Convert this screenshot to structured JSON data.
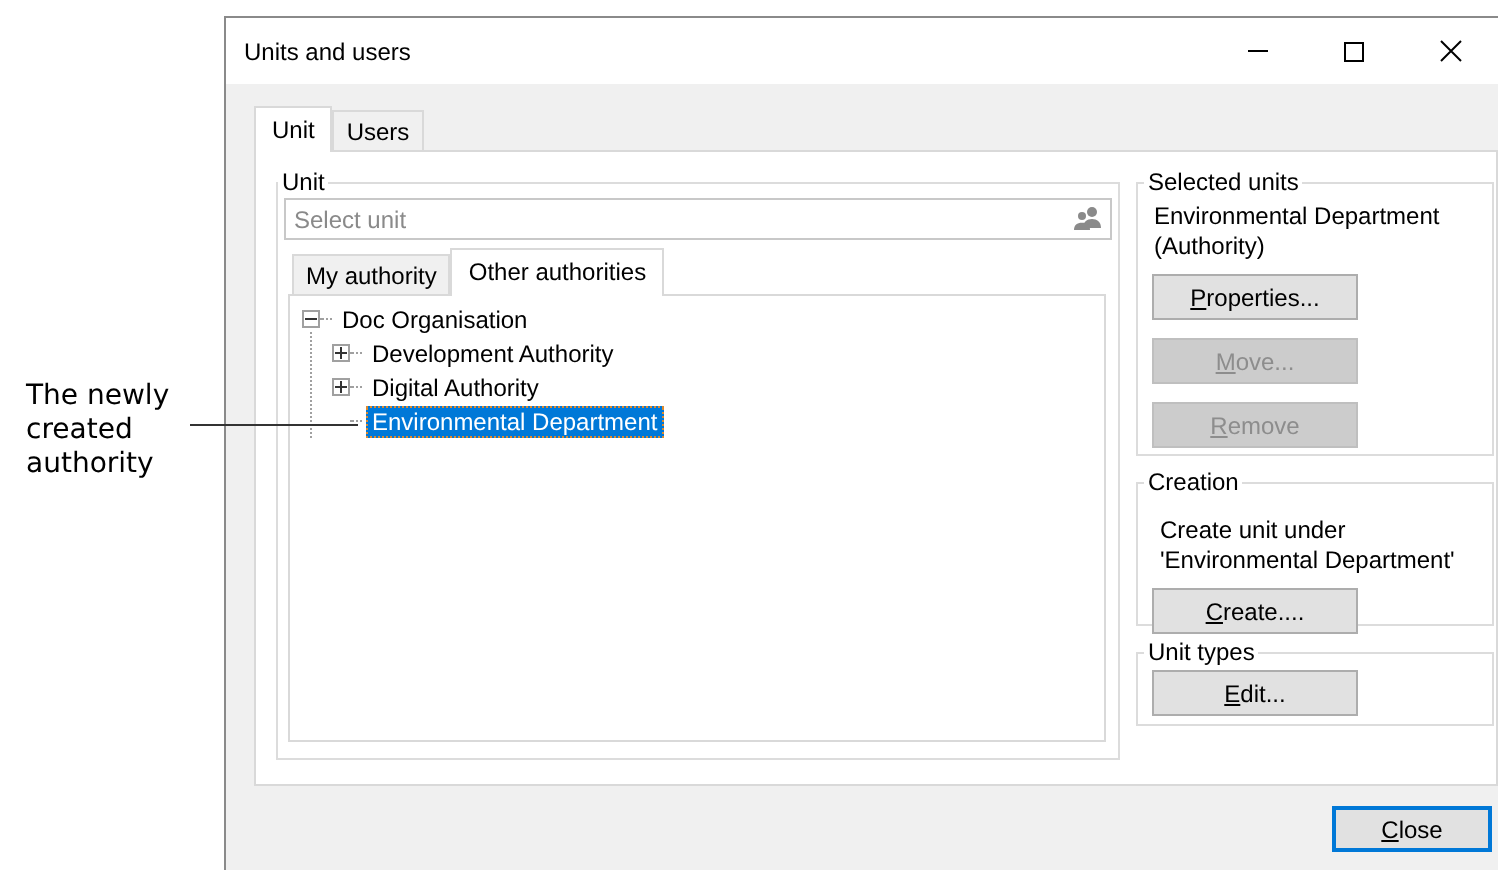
{
  "annotation": {
    "text": "The newly created authority"
  },
  "window": {
    "title": "Units and users"
  },
  "tabs": [
    {
      "label": "Unit",
      "selected": true
    },
    {
      "label": "Users",
      "selected": false
    }
  ],
  "unit_group": {
    "title": "Unit",
    "search": {
      "placeholder": "Select unit"
    },
    "tabs": [
      {
        "label": "My authority",
        "selected": false
      },
      {
        "label": "Other authorities",
        "selected": true
      }
    ],
    "tree": [
      {
        "label": "Doc Organisation",
        "kind": "branch",
        "expanded": true,
        "selected": false,
        "children": [
          {
            "label": "Development Authority",
            "kind": "branch",
            "expanded": false,
            "selected": false
          },
          {
            "label": "Digital Authority",
            "kind": "branch",
            "expanded": false,
            "selected": false
          },
          {
            "label": "Environmental Department",
            "kind": "leaf",
            "selected": true
          }
        ]
      }
    ]
  },
  "selected_units": {
    "title": "Selected units",
    "text": "Environmental Department (Authority)",
    "buttons": [
      {
        "label": "Properties...",
        "disabled": false,
        "mnemonic_underlined": true
      },
      {
        "label": "Move...",
        "disabled": true,
        "mnemonic_underlined": true
      },
      {
        "label": "Remove",
        "disabled": true,
        "mnemonic_underlined": true
      }
    ]
  },
  "creation": {
    "title": "Creation",
    "text": "Create unit under 'Environmental Department'",
    "buttons": [
      {
        "label": "Create....",
        "disabled": false,
        "mnemonic_underlined": true
      }
    ]
  },
  "unit_types": {
    "title": "Unit types",
    "buttons": [
      {
        "label": "Edit...",
        "disabled": false,
        "mnemonic_underlined": true
      }
    ]
  },
  "footer": {
    "buttons": [
      {
        "label": "Close",
        "disabled": false,
        "mnemonic_underlined": true,
        "default": true
      }
    ]
  }
}
